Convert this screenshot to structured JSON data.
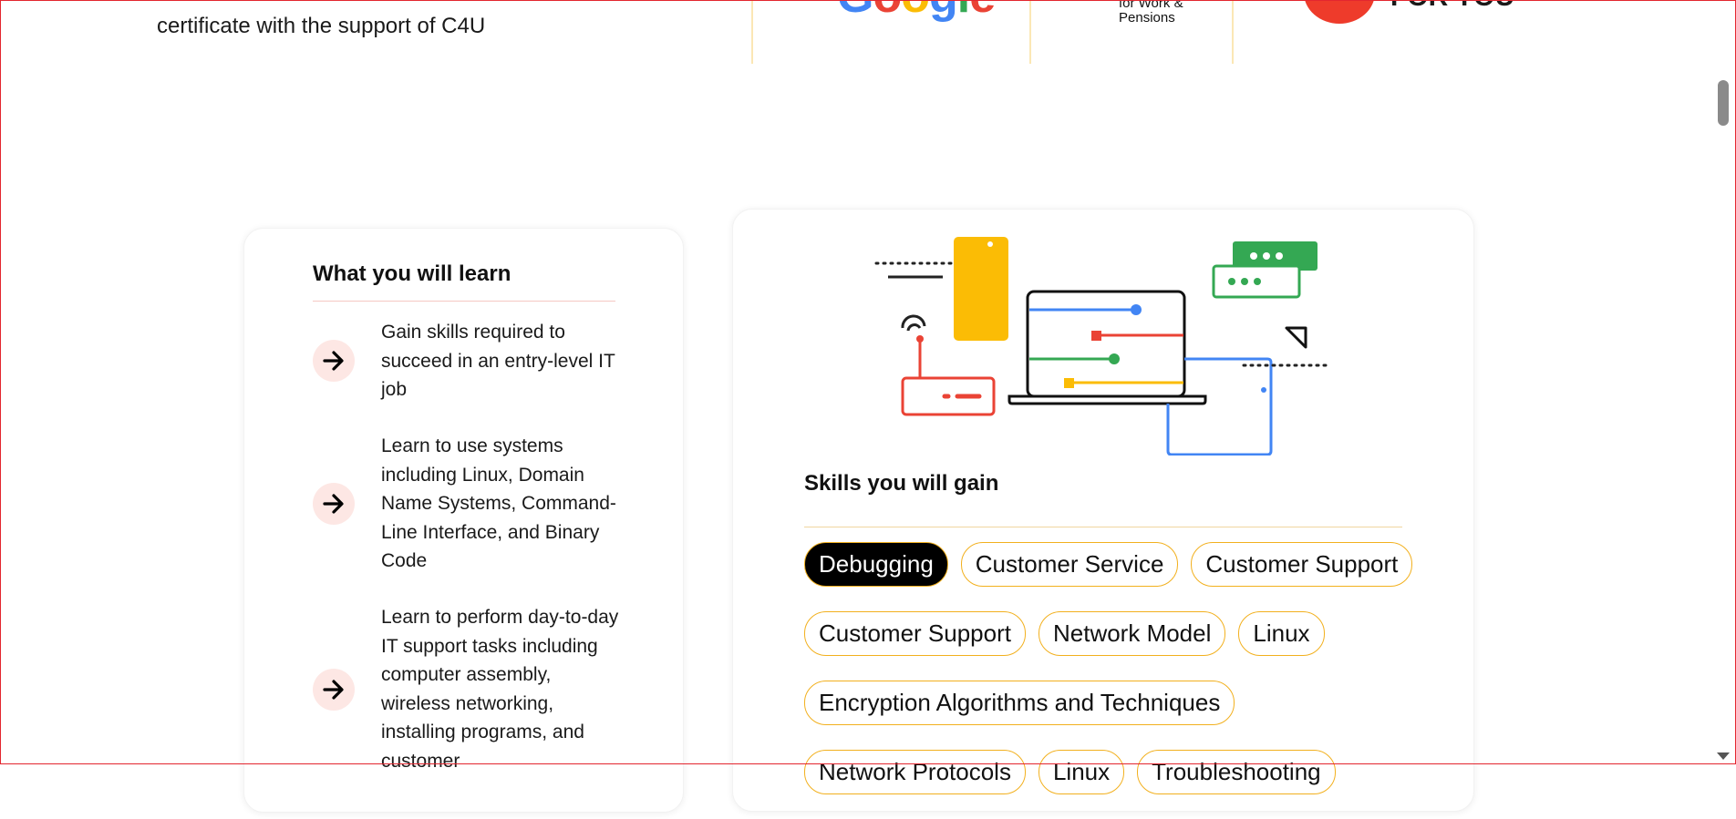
{
  "top": {
    "certificate_text": "certificate with the support of C4U",
    "partners": [
      {
        "name": "Google",
        "icon": "google-logo"
      },
      {
        "name": "Department for Work & Pensions",
        "visible_text": "for Work & Pensions",
        "icon": "dwp-logo"
      },
      {
        "name": "Coding for You",
        "visible_text": "FOR YOU",
        "icon": "c4u-logo"
      }
    ]
  },
  "learn": {
    "title": "What you will learn",
    "items": [
      {
        "text": "Gain skills required to succeed in an entry-level IT job",
        "icon": "arrow-right-icon"
      },
      {
        "text": "Learn to use systems including Linux, Domain Name Systems, Command-Line Interface, and Binary Code",
        "icon": "arrow-right-icon"
      },
      {
        "text": "Learn to perform day-to-day IT support tasks including computer assembly, wireless networking, installing programs, and customer",
        "icon": "arrow-right-icon"
      }
    ]
  },
  "skills": {
    "title": "Skills you will gain",
    "chips": [
      [
        "Debugging",
        "Customer Service",
        "Customer Support"
      ],
      [
        "Customer Support",
        "Network Model",
        "Linux"
      ],
      [
        "Encryption Algorithms and Techniques"
      ],
      [
        "Network Protocols",
        "Linux",
        "Troubleshooting"
      ]
    ],
    "active_chip": "Debugging"
  },
  "colors": {
    "accent": "#f2b01e",
    "badge": "#fde7e4",
    "frame": "#e3262f"
  }
}
